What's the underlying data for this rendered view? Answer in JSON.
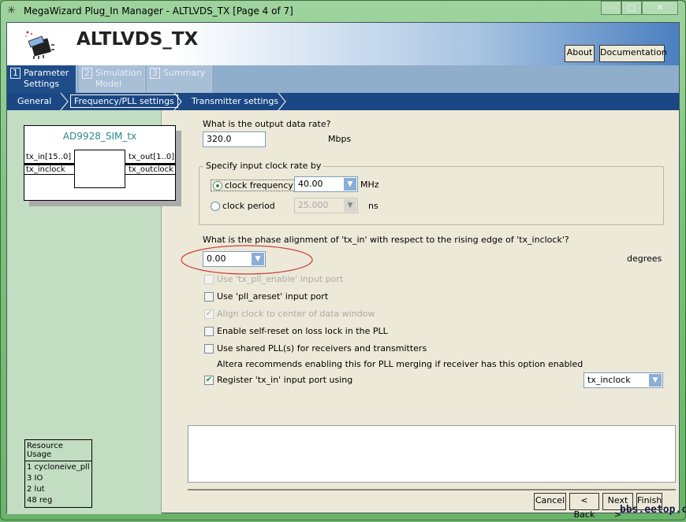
{
  "window": {
    "title": "MegaWizard Plug_In Manager - ALTLVDS_TX [Page 4 of 7]",
    "minimize": "–",
    "maximize": "□",
    "close": "✕"
  },
  "header": {
    "title": "ALTLVDS_TX",
    "about": "About",
    "documentation": "Documentation"
  },
  "tabs": [
    {
      "num": "1",
      "label": "Parameter Settings"
    },
    {
      "num": "2",
      "label": "Simulation Model"
    },
    {
      "num": "3",
      "label": "Summary"
    }
  ],
  "subnav": [
    "General",
    "Frequency/PLL settings",
    "Transmitter settings"
  ],
  "symbol": {
    "name": "AD9928_SIM_tx",
    "in_ports": [
      "tx_in[15..0]",
      "tx_inclock"
    ],
    "out_ports": [
      "tx_out[1..0]",
      "tx_outclock"
    ]
  },
  "resource": {
    "title": "Resource Usage",
    "items": [
      "1 cycloneive_pll",
      "3 IO",
      "2 lut",
      "48 reg"
    ]
  },
  "form": {
    "data_rate_q": "What is the output data rate?",
    "data_rate": "320.0",
    "data_rate_unit": "Mbps",
    "clock_group": "Specify input clock rate by",
    "clock_freq_label": "clock frequency",
    "clock_freq": "40.00",
    "clock_freq_unit": "MHz",
    "clock_period_label": "clock period",
    "clock_period": "25.000",
    "clock_period_unit": "ns",
    "phase_q": "What is the phase alignment of 'tx_in' with respect to the rising edge of 'tx_inclock'?",
    "phase": "0.00",
    "phase_unit": "degrees",
    "opt_pll_enable": "Use 'tx_pll_enable' input port",
    "opt_pll_areset": "Use 'pll_areset' input port",
    "opt_align": "Align clock to center of data window",
    "opt_self_reset": "Enable self-reset on loss lock in the PLL",
    "opt_shared_pll": "Use shared PLL(s) for receivers and transmitters",
    "shared_note": "Altera recommends enabling this for PLL merging if receiver has this option enabled",
    "opt_register": "Register 'tx_in' input port using",
    "register_clock": "tx_inclock"
  },
  "footer": {
    "cancel": "Cancel",
    "back": "< Back",
    "next": "Next >",
    "finish": "Finish"
  },
  "watermark": "bbs.eetop.cn"
}
